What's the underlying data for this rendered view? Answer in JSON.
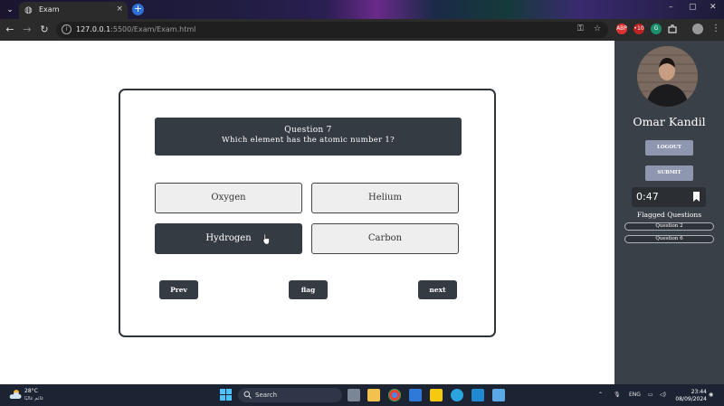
{
  "browser": {
    "tab_title": "Exam",
    "tab_close": "×",
    "new_tab": "+",
    "url_host": "127.0.0.1",
    "url_path": ":5500/Exam/Exam.html",
    "window_minimize": "–",
    "window_maximize": "▢",
    "window_close": "✕",
    "ext_labels": [
      "ABP",
      "•10",
      "G"
    ]
  },
  "exam": {
    "question_number": "Question 7",
    "question_text": "Which element has the atomic number 1?",
    "answers": [
      "Oxygen",
      "Helium",
      "Hydrogen",
      "Carbon"
    ],
    "selected_answer": "Hydrogen",
    "prev_label": "Prev",
    "flag_label": "flag",
    "next_label": "next"
  },
  "sidebar": {
    "user_name": "Omar Kandil",
    "logout_label": "LOGOUT",
    "submit_label": "SUBMIT",
    "timer": "0:47",
    "flagged_title": "Flagged Questions",
    "flagged_items": [
      "Question 2",
      "Question 6"
    ]
  },
  "taskbar": {
    "weather_temp": "28°C",
    "weather_desc": "غائم غالبًا",
    "search_placeholder": "Search",
    "language": "ENG",
    "time": "23:44",
    "date": "08/09/2024"
  },
  "colors": {
    "dark_panel": "#353b43",
    "sidebar_bg": "#3a4048",
    "sidebar_button": "#8e96b0",
    "answer_bg": "#eeeeee"
  }
}
